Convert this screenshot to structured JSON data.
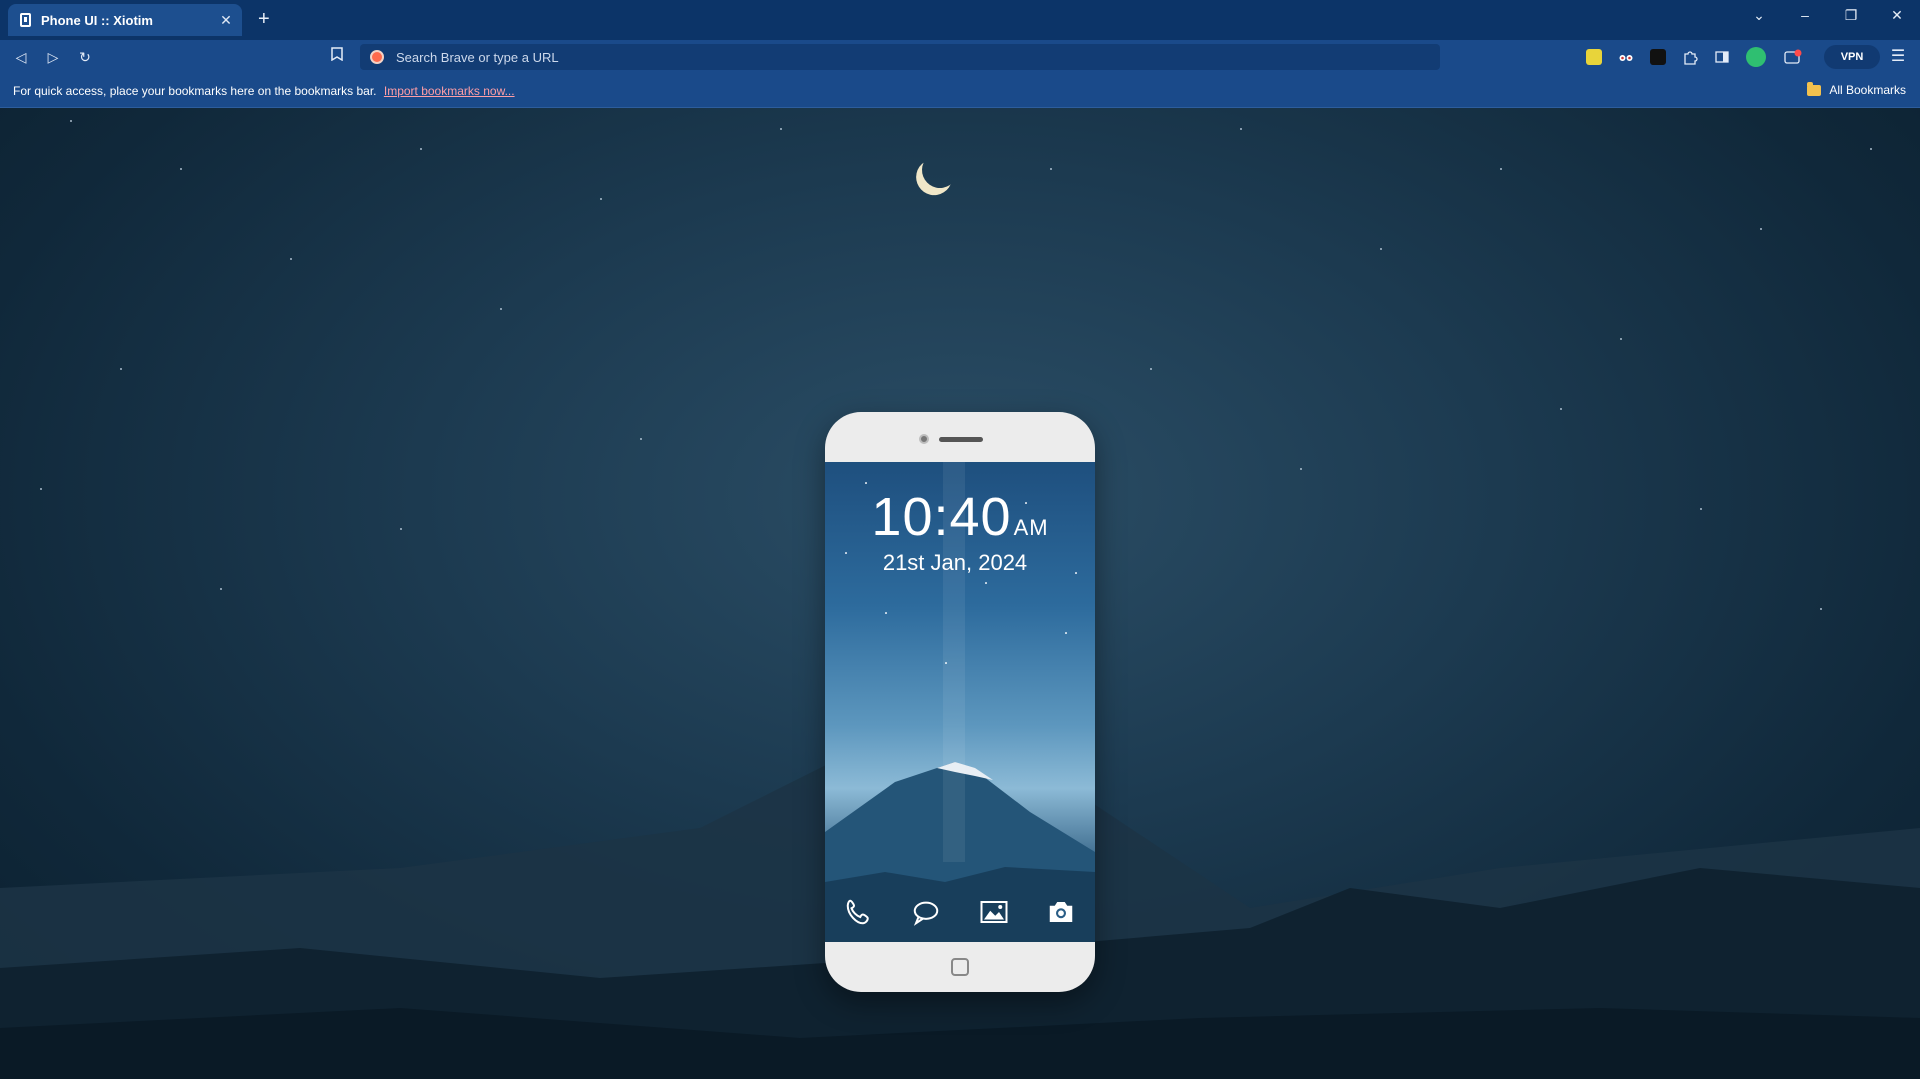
{
  "browser": {
    "tab": {
      "title": "Phone UI :: Xiotim",
      "close_glyph": "✕",
      "favicon": "phone-icon"
    },
    "new_tab_glyph": "+",
    "window_controls": {
      "list": "⌄",
      "minimize": "–",
      "restore": "❐",
      "close": "✕"
    },
    "toolbar": {
      "back": "◁",
      "forward": "▷",
      "reload": "↻",
      "bookmark": "🔖",
      "address_placeholder": "Search Brave or type a URL",
      "vpn_label": "VPN",
      "menu": "☰"
    },
    "bookmarks_bar": {
      "message": "For quick access, place your bookmarks here on the bookmarks bar.",
      "import_link": "Import bookmarks now...",
      "all_bookmarks": "All Bookmarks"
    }
  },
  "phone": {
    "time": "10:40",
    "ampm": "AM",
    "date": "21st Jan, 2024",
    "dock": [
      "phone-call-icon",
      "message-bubble-icon",
      "gallery-icon",
      "camera-icon"
    ]
  },
  "colors": {
    "tabstrip": "#0c3468",
    "toolbar": "#1a4a8a",
    "link": "#ff9ea6",
    "phone_body": "#ececec"
  }
}
